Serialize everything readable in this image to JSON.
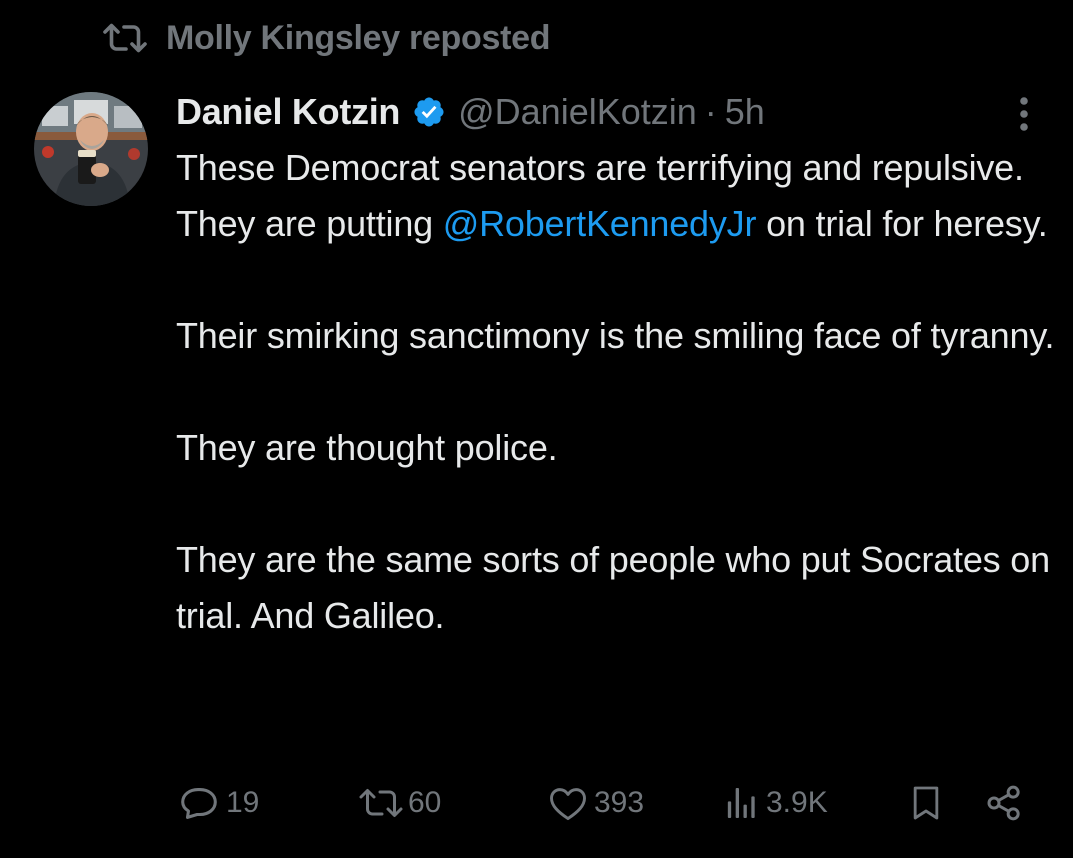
{
  "social_context": {
    "icon": "repost-icon",
    "label": "Molly Kingsley reposted"
  },
  "tweet": {
    "author": {
      "display_name": "Daniel Kotzin",
      "verified": true,
      "handle": "@DanielKotzin",
      "separator": "·",
      "time": "5h",
      "avatar_icon": "avatar"
    },
    "more_icon": "more-options-icon",
    "body": {
      "p1_before": "These Democrat senators are terrifying and repulsive. They are putting ",
      "p1_mention": "@RobertKennedyJr",
      "p1_after": " on trial for heresy.",
      "p2": "Their smirking sanctimony is the smiling face of tyranny.",
      "p3": "They are thought police.",
      "p4": "They are the same sorts of people who put Socrates on trial. And Galileo."
    },
    "actions": {
      "replies": "19",
      "reposts": "60",
      "likes": "393",
      "views": "3.9K"
    }
  },
  "colors": {
    "background": "#000000",
    "text": "#e7e9ea",
    "secondary": "#71767b",
    "accent": "#1d9bf0"
  }
}
